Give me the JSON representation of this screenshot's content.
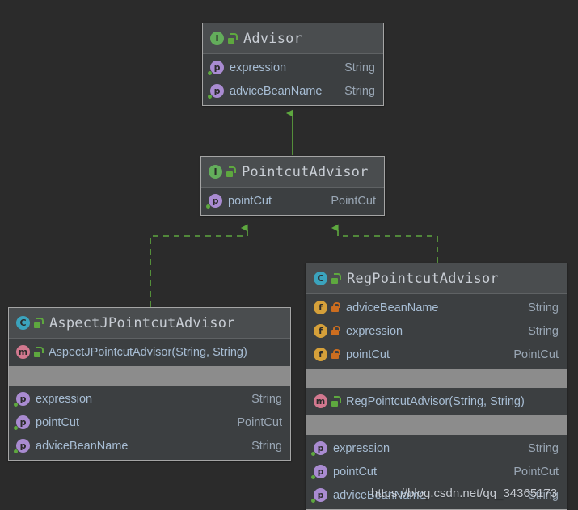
{
  "diagram": {
    "background_color": "#2b2b2b",
    "edge_color": "#5ea83f",
    "watermark": "https://blog.csdn.net/qq_34365173"
  },
  "icons": {
    "interface": "interface-icon",
    "class": "class-icon",
    "property": "property-icon",
    "field": "field-icon",
    "method": "method-icon",
    "lock_public": "unlocked-padlock-icon",
    "lock_private": "locked-padlock-icon"
  },
  "nodes": [
    {
      "id": "advisor",
      "title": "Advisor",
      "stereotype": "I",
      "visibility": "public",
      "members": [
        {
          "name": "expression",
          "type": "String",
          "kind": "property",
          "visibility": "public"
        },
        {
          "name": "adviceBeanName",
          "type": "String",
          "kind": "property",
          "visibility": "public"
        }
      ]
    },
    {
      "id": "pointcutadvisor",
      "title": "PointcutAdvisor",
      "stereotype": "I",
      "visibility": "public",
      "members": [
        {
          "name": "pointCut",
          "type": "PointCut",
          "kind": "property",
          "visibility": "public"
        }
      ]
    },
    {
      "id": "aspectjpointcutadvisor",
      "title": "AspectJPointcutAdvisor",
      "stereotype": "C",
      "visibility": "public",
      "methods": [
        {
          "name": "AspectJPointcutAdvisor(String, String)",
          "type": "",
          "kind": "method",
          "visibility": "public"
        }
      ],
      "properties": [
        {
          "name": "expression",
          "type": "String",
          "kind": "property",
          "visibility": "public"
        },
        {
          "name": "pointCut",
          "type": "PointCut",
          "kind": "property",
          "visibility": "public"
        },
        {
          "name": "adviceBeanName",
          "type": "String",
          "kind": "property",
          "visibility": "public"
        }
      ]
    },
    {
      "id": "regpointcutadvisor",
      "title": "RegPointcutAdvisor",
      "stereotype": "C",
      "visibility": "public",
      "fields": [
        {
          "name": "adviceBeanName",
          "type": "String",
          "kind": "field",
          "visibility": "private"
        },
        {
          "name": "expression",
          "type": "String",
          "kind": "field",
          "visibility": "private"
        },
        {
          "name": "pointCut",
          "type": "PointCut",
          "kind": "field",
          "visibility": "private"
        }
      ],
      "methods": [
        {
          "name": "RegPointcutAdvisor(String, String)",
          "type": "",
          "kind": "method",
          "visibility": "public"
        }
      ],
      "properties": [
        {
          "name": "expression",
          "type": "String",
          "kind": "property",
          "visibility": "public"
        },
        {
          "name": "pointCut",
          "type": "PointCut",
          "kind": "property",
          "visibility": "public"
        },
        {
          "name": "adviceBeanName",
          "type": "String",
          "kind": "property",
          "visibility": "public"
        }
      ]
    }
  ],
  "edges": [
    {
      "from": "pointcutadvisor",
      "to": "advisor",
      "style": "solid",
      "arrow": "triangle"
    },
    {
      "from": "aspectjpointcutadvisor",
      "to": "pointcutadvisor",
      "style": "dashed",
      "arrow": "triangle"
    },
    {
      "from": "regpointcutadvisor",
      "to": "pointcutadvisor",
      "style": "dashed",
      "arrow": "triangle"
    }
  ]
}
